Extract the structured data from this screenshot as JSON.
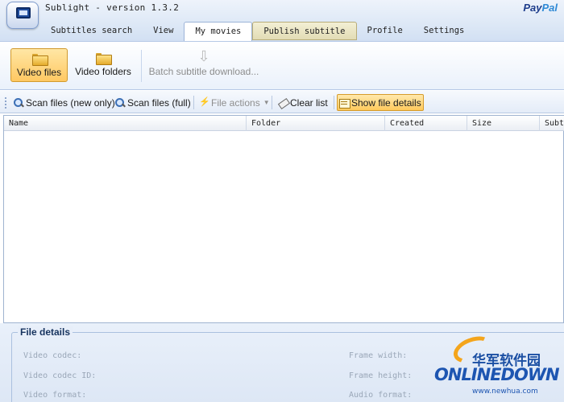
{
  "window": {
    "title": "Sublight - version 1.3.2",
    "paypal": {
      "pay": "Pay",
      "pal": "Pal"
    }
  },
  "tabs": [
    {
      "label": "Subtitles search"
    },
    {
      "label": "View"
    },
    {
      "label": "My movies",
      "active": true
    },
    {
      "label": "Publish subtitle",
      "highlighted": true
    },
    {
      "label": "Profile"
    },
    {
      "label": "Settings"
    }
  ],
  "ribbon": {
    "video_files": "Video files",
    "video_folders": "Video folders",
    "batch_download": "Batch subtitle download..."
  },
  "toolbar": {
    "scan_new": "Scan files (new only)",
    "scan_full": "Scan files (full)",
    "file_actions": "File actions",
    "clear_list": "Clear list",
    "show_details": "Show file details"
  },
  "grid": {
    "columns": [
      "Name",
      "Folder",
      "Created",
      "Size",
      "Subt"
    ],
    "rows": []
  },
  "file_details": {
    "legend": "File details",
    "video_codec": "Video codec:",
    "video_codec_id": "Video codec ID:",
    "video_format": "Video format:",
    "frame_width": "Frame width:",
    "frame_height": "Frame height:",
    "audio_format": "Audio format:"
  },
  "watermark": {
    "chinese": "华军软件园",
    "brand": "ONLINEDOWN",
    "url": "www.newhua.com"
  },
  "colors": {
    "accent_active": "#ffc862",
    "ribbon_blue": "#dde8f6",
    "watermark_blue": "#1d55b1",
    "watermark_orange": "#f4a51c"
  }
}
